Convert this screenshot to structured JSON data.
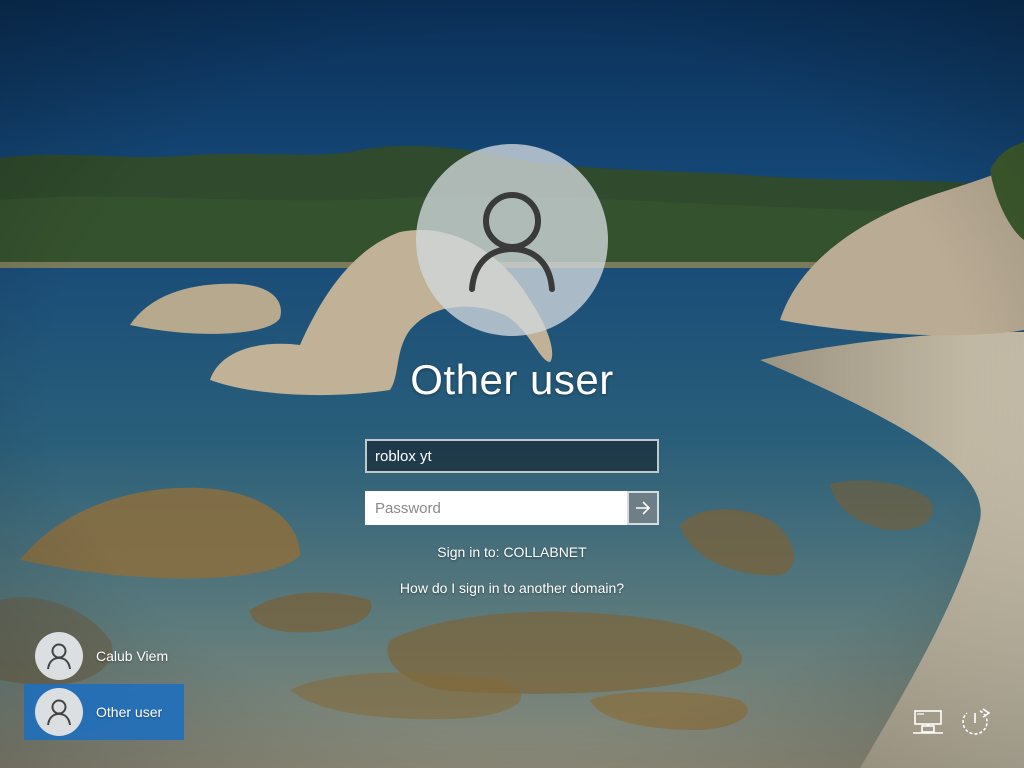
{
  "login": {
    "user_title": "Other user",
    "username_value": "roblox yt",
    "password_placeholder": "Password",
    "sign_in_to": "Sign in to: COLLABNET",
    "other_domain_link": "How do I sign in to another domain?"
  },
  "user_list": [
    {
      "name": "Calub Viem",
      "selected": false
    },
    {
      "name": "Other user",
      "selected": true
    }
  ],
  "icons": {
    "avatar": "user-silhouette-icon",
    "submit": "arrow-right-icon",
    "network": "network-icon",
    "power": "power-icon"
  },
  "colors": {
    "selected_tile": "#1e6ebe",
    "text": "#ffffff"
  }
}
